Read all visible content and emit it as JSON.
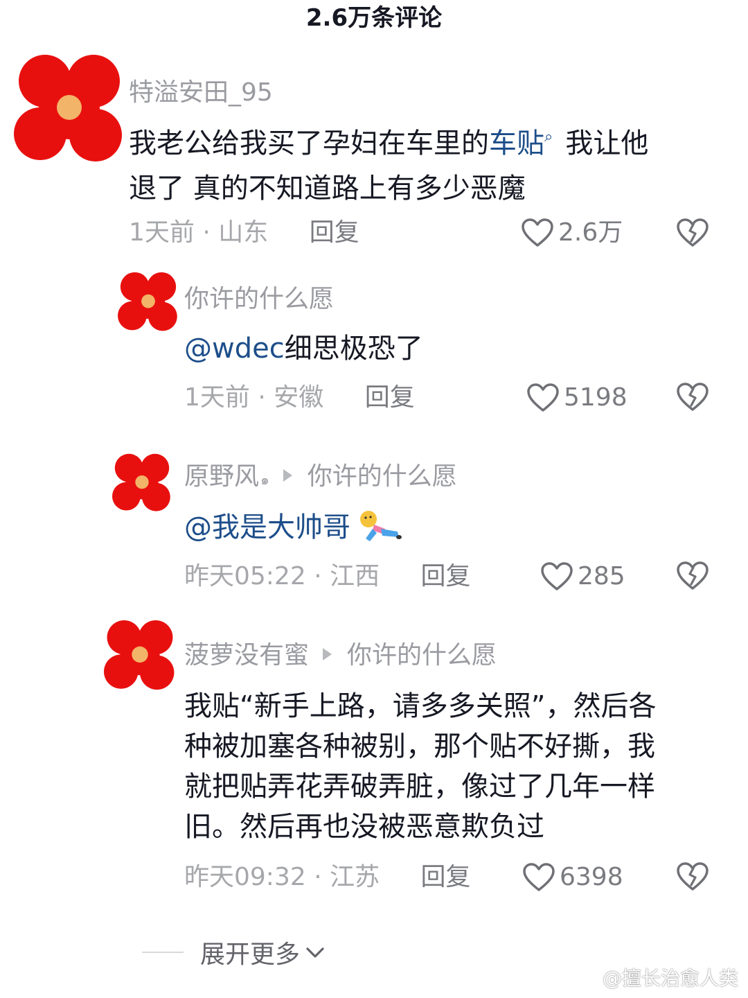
{
  "header": {
    "title": "2.6万条评论"
  },
  "comments": [
    {
      "user": "特溢安田_95",
      "text_before": "我老公给我买了孕妇在车里的",
      "link": "车贴",
      "text_after_line1": "我让他",
      "text_line2": "退了 真的不知道路上有多少恶魔",
      "time": "1天前 · 山东",
      "reply_label": "回复",
      "likes": "2.6万"
    },
    {
      "user": "你许的什么愿",
      "mention": "@wdec",
      "text": "细思极恐了",
      "time": "1天前 · 安徽",
      "reply_label": "回复",
      "likes": "5198"
    },
    {
      "user": "原野风",
      "badge": "๑",
      "reply_to": "你许的什么愿",
      "mention": "@我是大帅哥",
      "time": "昨天05:22 · 江西",
      "reply_label": "回复",
      "likes": "285"
    },
    {
      "user": "菠萝没有蜜",
      "reply_to": "你许的什么愿",
      "lines": [
        "我贴“新手上路，请多多关照”，然后各",
        "种被加塞各种被别，那个贴不好撕，我",
        "就把贴弄花弄破弄脏，像过了几年一样",
        "旧。然后再也没被恶意欺负过"
      ],
      "time": "昨天09:32 · 江苏",
      "reply_label": "回复",
      "likes": "6398"
    }
  ],
  "footer": {
    "expand_label": "展开更多",
    "watermark": "@擅长治愈人类"
  },
  "colors": {
    "avatar_red": "#e8100f",
    "avatar_center": "#f2b468",
    "link_blue": "#1d4e8a",
    "meta_gray": "#a6a7ab"
  },
  "icons": {
    "like": "heart-outline-icon",
    "dislike": "broken-heart-icon",
    "search": "search-icon",
    "expand": "chevron-down-icon"
  }
}
